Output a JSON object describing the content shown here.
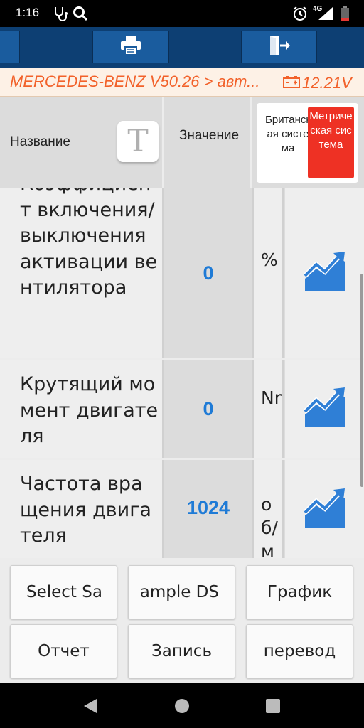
{
  "status_bar": {
    "time": "1:16",
    "network": "4G"
  },
  "toolbar": {
    "print_icon": "printer-icon",
    "exit_icon": "exit-icon"
  },
  "title_bar": {
    "title": "MERCEDES-BENZ V50.26 > авт...",
    "voltage": "12.21V",
    "battery_icon": "battery-icon"
  },
  "header": {
    "name_label": "Название",
    "text_size_button": "T",
    "value_label": "Значение",
    "units_british": "Британская система",
    "units_metric": "Метрическая система"
  },
  "rows": [
    {
      "name": "Коэффициент включения/выключения активации вентилятора",
      "value": "0",
      "unit": "%"
    },
    {
      "name": "Крутящий момент двигателя",
      "value": "0",
      "unit": "Nm"
    },
    {
      "name": "Частота вращения двигателя",
      "value": "1024",
      "unit": "об/мин"
    }
  ],
  "buttons": {
    "select_sample": "Select Sample DS",
    "select_sample_left": "Select Sa",
    "select_sample_right": "ample DS",
    "graph": "График",
    "report": "Отчет",
    "record": "Запись",
    "translate": "перевод"
  },
  "colors": {
    "accent_orange": "#f2612a",
    "value_blue": "#1f7bd6",
    "metric_red": "#ee3124",
    "toolbar_blue": "#0d3f73"
  }
}
